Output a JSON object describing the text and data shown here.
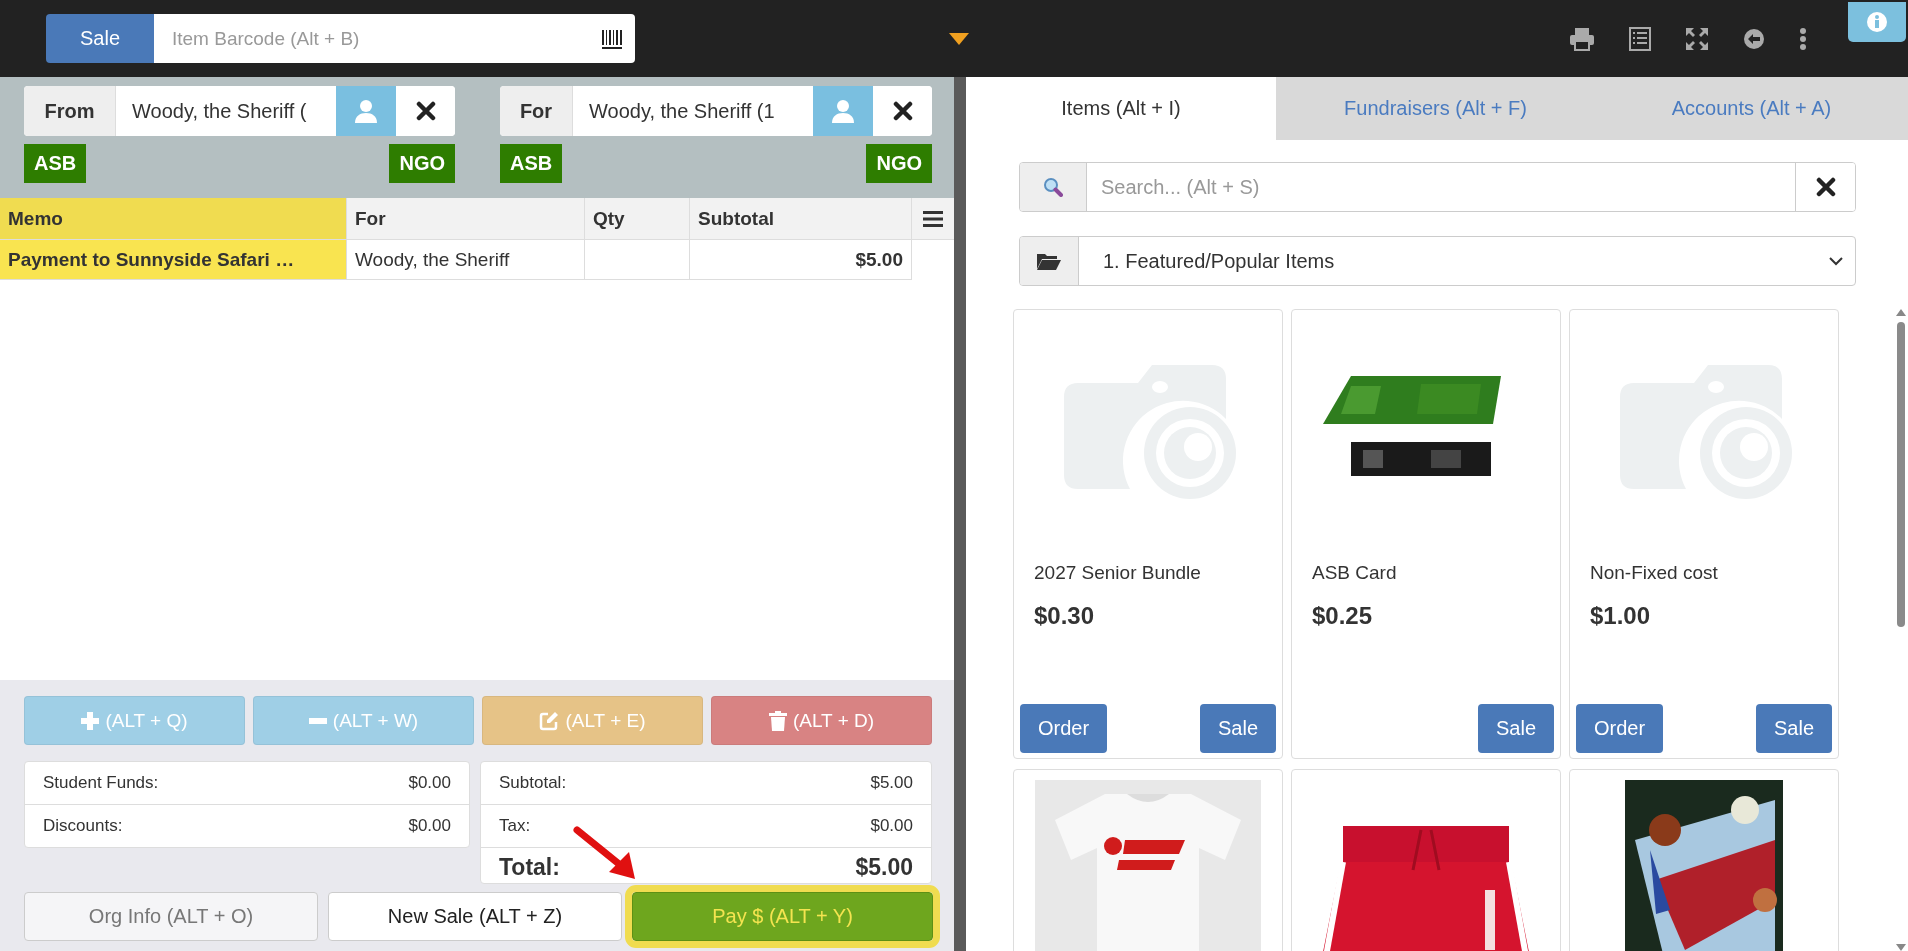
{
  "topbar": {
    "mode_button": "Sale",
    "barcode_placeholder": "Item Barcode (Alt + B)"
  },
  "parties": [
    {
      "label": "From",
      "value": "Woody, the Sheriff (",
      "badges": [
        "ASB",
        "NGO"
      ]
    },
    {
      "label": "For",
      "value": "Woody, the Sheriff (1",
      "badges": [
        "ASB",
        "NGO"
      ]
    }
  ],
  "table": {
    "columns": [
      {
        "label": "Memo",
        "highlighted": true
      },
      {
        "label": "For",
        "highlighted": false
      },
      {
        "label": "Qty",
        "highlighted": false
      },
      {
        "label": "Subtotal",
        "highlighted": false
      }
    ],
    "rows": [
      {
        "memo": "Payment to Sunnyside Safari …",
        "for": "Woody, the Sheriff",
        "subtotal": "$5.00"
      }
    ]
  },
  "actions": [
    {
      "kind": "add",
      "label": "(ALT + Q)"
    },
    {
      "kind": "remove",
      "label": "(ALT + W)"
    },
    {
      "kind": "edit",
      "label": "(ALT + E)"
    },
    {
      "kind": "delete",
      "label": "(ALT + D)"
    }
  ],
  "funds": [
    {
      "label": "Student Funds:",
      "value": "$0.00"
    },
    {
      "label": "Discounts:",
      "value": "$0.00"
    }
  ],
  "totals": [
    {
      "kind": "line",
      "label": "Subtotal:",
      "value": "$5.00"
    },
    {
      "kind": "line",
      "label": "Tax:",
      "value": "$0.00"
    },
    {
      "kind": "grand",
      "label": "Total:",
      "value": "$5.00"
    }
  ],
  "footer_buttons": [
    {
      "kind": "secondary",
      "label": "Org Info (ALT + O)",
      "highlighted": false
    },
    {
      "kind": "default",
      "label": "New Sale (ALT + Z)",
      "highlighted": false
    },
    {
      "kind": "pay",
      "label": "Pay $ (ALT + Y)",
      "highlighted": true
    }
  ],
  "tabs": [
    {
      "label": "Items (Alt + I)",
      "selected": true
    },
    {
      "label": "Fundraisers (Alt + F)",
      "selected": false
    },
    {
      "label": "Accounts (Alt + A)",
      "selected": false
    }
  ],
  "search": {
    "placeholder": "Search... (Alt + S)"
  },
  "category": {
    "value": "1. Featured/Popular Items"
  },
  "items": [
    {
      "kind": "placeholder",
      "name": "2027 Senior Bundle",
      "price": "$0.30",
      "buttons": [
        {
          "kind": "order",
          "label": "Order"
        },
        {
          "kind": "sale",
          "label": "Sale"
        }
      ]
    },
    {
      "kind": "picture",
      "name": "ASB Card",
      "price": "$0.25",
      "buttons": [
        {
          "kind": "sale",
          "label": "Sale"
        }
      ]
    },
    {
      "kind": "placeholder",
      "name": "Non-Fixed cost",
      "price": "$1.00",
      "buttons": [
        {
          "kind": "order",
          "label": "Order"
        },
        {
          "kind": "sale",
          "label": "Sale"
        }
      ]
    },
    {
      "kind": "picture"
    },
    {
      "kind": "picture"
    },
    {
      "kind": "picture"
    }
  ]
}
